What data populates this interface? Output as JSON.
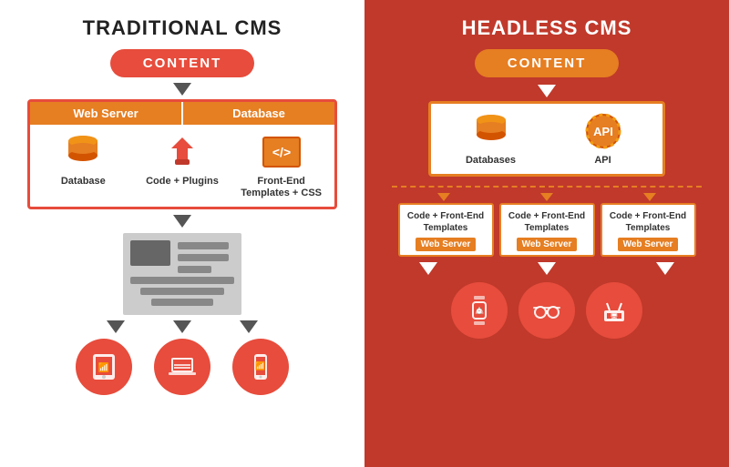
{
  "left": {
    "title": "TRADITIONAL CMS",
    "content_label": "CONTENT",
    "server_label": "Web Server",
    "database_header_label": "Database",
    "items": [
      {
        "icon": "database",
        "label": "Database"
      },
      {
        "icon": "plugins",
        "label": "Code + Plugins"
      },
      {
        "icon": "frontend",
        "label": "Front-End Templates + CSS"
      }
    ],
    "devices": [
      "tablet",
      "laptop",
      "phone"
    ]
  },
  "right": {
    "title": "HEADLESS CMS",
    "content_label": "CONTENT",
    "items": [
      {
        "icon": "database",
        "label": "Databases"
      },
      {
        "icon": "api",
        "label": "API"
      }
    ],
    "webservers": [
      {
        "text": "Code + Front-End Templates",
        "label": "Web Server"
      },
      {
        "text": "Code + Front-End Templates",
        "label": "Web Server"
      },
      {
        "text": "Code + Front-End Templates",
        "label": "Web Server"
      }
    ],
    "devices": [
      "watch",
      "glasses",
      "router"
    ]
  }
}
